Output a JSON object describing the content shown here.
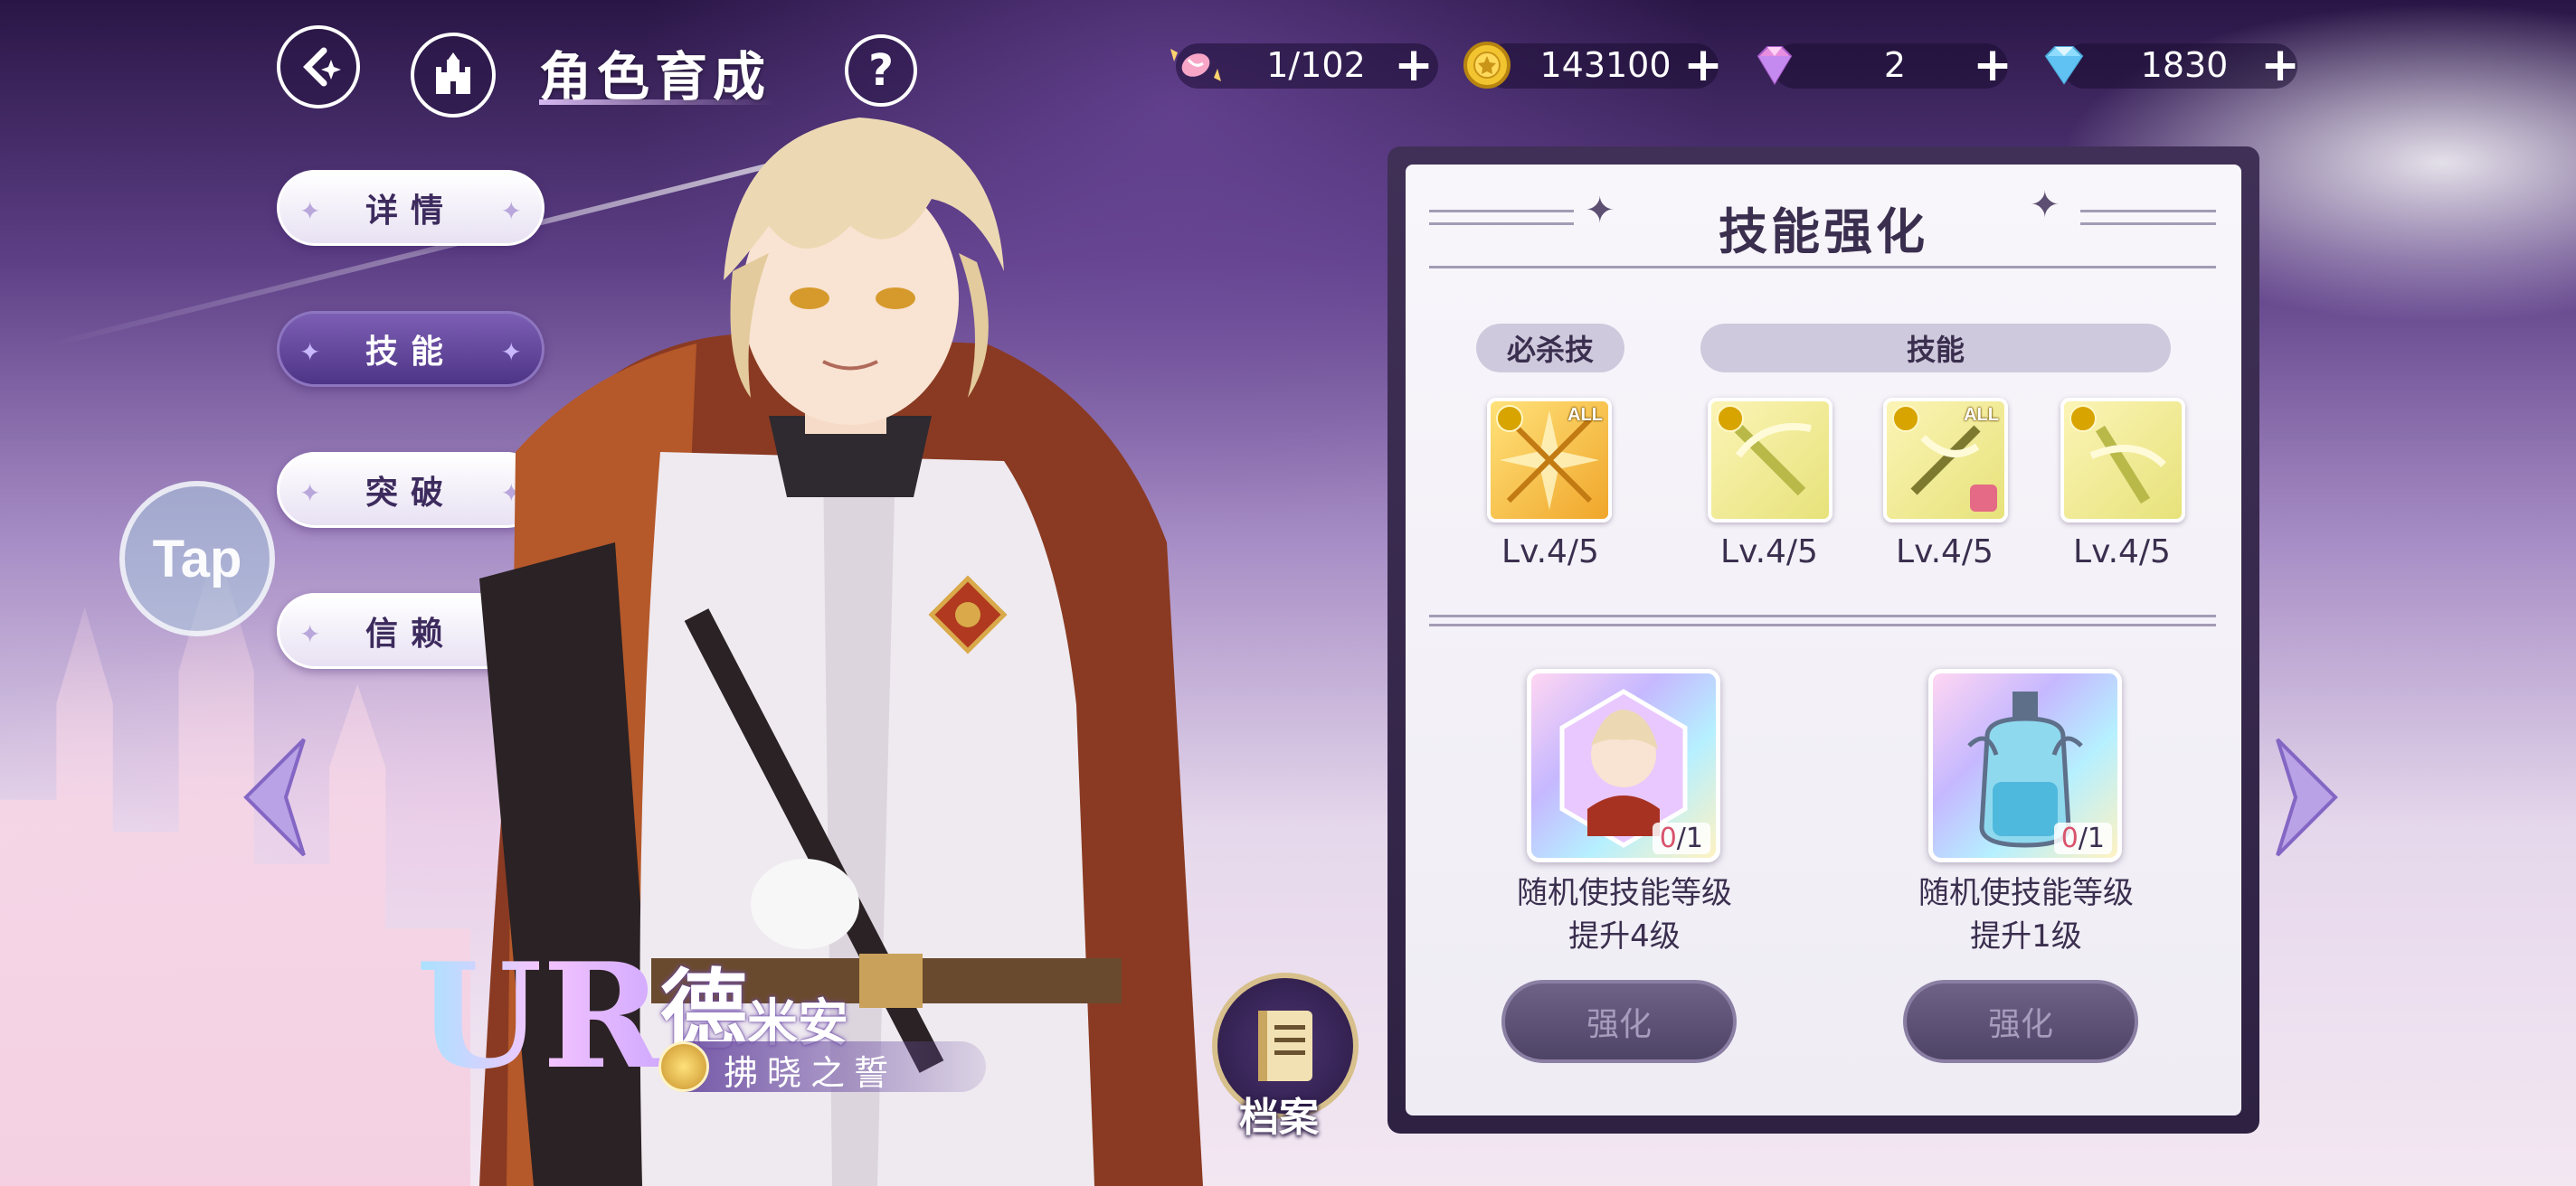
{
  "header": {
    "title": "角色育成",
    "back_icon": "back-arrow-icon",
    "home_icon": "castle-icon",
    "help_label": "?"
  },
  "resources": [
    {
      "icon": "candy-icon",
      "value": "1/102"
    },
    {
      "icon": "gold-coin-icon",
      "value": "143100"
    },
    {
      "icon": "pink-diamond-icon",
      "value": "2"
    },
    {
      "icon": "blue-diamond-icon",
      "value": "1830"
    }
  ],
  "tabs": [
    {
      "label": "详情",
      "active": false
    },
    {
      "label": "技能",
      "active": true
    },
    {
      "label": "突破",
      "active": false
    },
    {
      "label": "信赖",
      "active": false
    }
  ],
  "tap_label": "Tap",
  "character": {
    "rarity": "UR",
    "name": "德",
    "name_small": "米安",
    "title": "拂晓之誓"
  },
  "archive_label": "档案",
  "panel": {
    "title": "技能强化",
    "ultimate_label": "必杀技",
    "skills_label": "技能",
    "skills": [
      {
        "level": "Lv.4/5",
        "badge": "ALL"
      },
      {
        "level": "Lv.4/5",
        "badge": ""
      },
      {
        "level": "Lv.4/5",
        "badge": "ALL"
      },
      {
        "level": "Lv.4/5",
        "badge": ""
      }
    ],
    "items": [
      {
        "owned": "0",
        "total": "/1",
        "desc_line1": "随机使技能等级",
        "desc_line2": "提升4级",
        "button": "强化"
      },
      {
        "owned": "0",
        "total": "/1",
        "desc_line1": "随机使技能等级",
        "desc_line2": "提升1级",
        "button": "强化"
      }
    ]
  },
  "colors": {
    "accent_purple": "#4e3486",
    "panel_bg": "#f8f6fb",
    "text_dark": "#3b2f4f",
    "count_red": "#d9536d"
  }
}
